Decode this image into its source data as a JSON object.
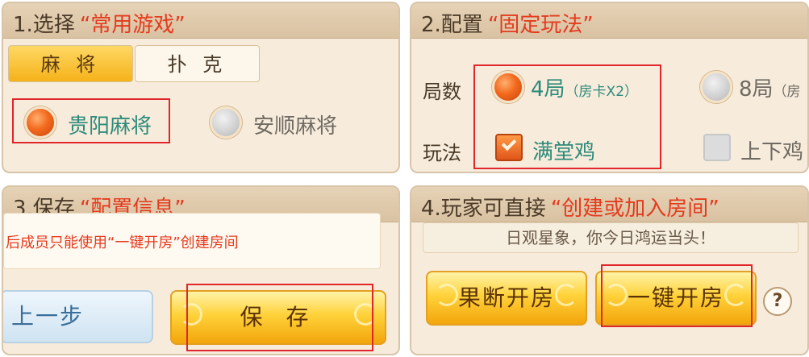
{
  "panel1": {
    "title_prefix": "1.选择",
    "title_highlight": "“常用游戏”",
    "tabs": [
      {
        "label": "麻 将",
        "active": true
      },
      {
        "label": "扑 克",
        "active": false
      }
    ],
    "options": [
      {
        "label": "贵阳麻将",
        "selected": true
      },
      {
        "label": "安顺麻将",
        "selected": false
      }
    ]
  },
  "panel2": {
    "title_prefix": "2.配置",
    "title_highlight": "“固定玩法”",
    "rounds_label": "局数",
    "rounds": [
      {
        "label": "4局",
        "sub": "（房卡X2）",
        "selected": true
      },
      {
        "label": "8局",
        "sub": "（房",
        "selected": false
      }
    ],
    "rules_label": "玩法",
    "rules": [
      {
        "label": "满堂鸡",
        "checked": true
      },
      {
        "label": "上下鸡",
        "checked": false
      }
    ]
  },
  "panel3": {
    "title_prefix": "3.保存",
    "title_highlight": "“配置信息”",
    "info": "后成员只能使用“一键开房”创建房间",
    "prev_button": "上一步",
    "save_button": "保 存"
  },
  "panel4": {
    "title_prefix": "4.玩家可直接",
    "title_highlight": "“创建或加入房间”",
    "motto": "日观星象，你今日鸿运当头！",
    "decisive_button": "果断开房",
    "onekey_button": "一键开房",
    "help_label": "?"
  },
  "colors": {
    "highlight_red": "#e53a1e",
    "selected_teal": "#2e8a7a",
    "gold": "#ffd23a",
    "panel_bg": "#f7ecdc"
  }
}
